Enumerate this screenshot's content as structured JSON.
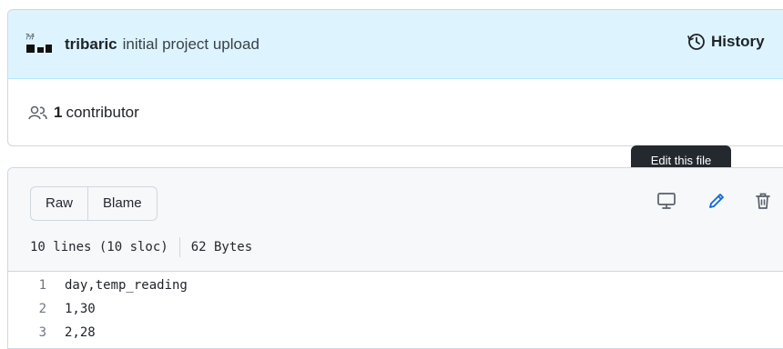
{
  "commit": {
    "author": "tribaric",
    "message": "initial project upload",
    "history_label": "History"
  },
  "contributors": {
    "count": "1",
    "label": "contributor"
  },
  "file_actions": {
    "raw_label": "Raw",
    "blame_label": "Blame",
    "lines_info": "10 lines (10 sloc)",
    "size_info": "62 Bytes",
    "tooltip": "Edit this file",
    "icons": [
      "desktop-icon",
      "pencil-icon",
      "trash-icon"
    ],
    "accent_color": "#0969da"
  },
  "code_lines": [
    {
      "number": "1",
      "text": "day,temp_reading"
    },
    {
      "number": "2",
      "text": "1,30"
    },
    {
      "number": "3",
      "text": "2,28"
    }
  ]
}
